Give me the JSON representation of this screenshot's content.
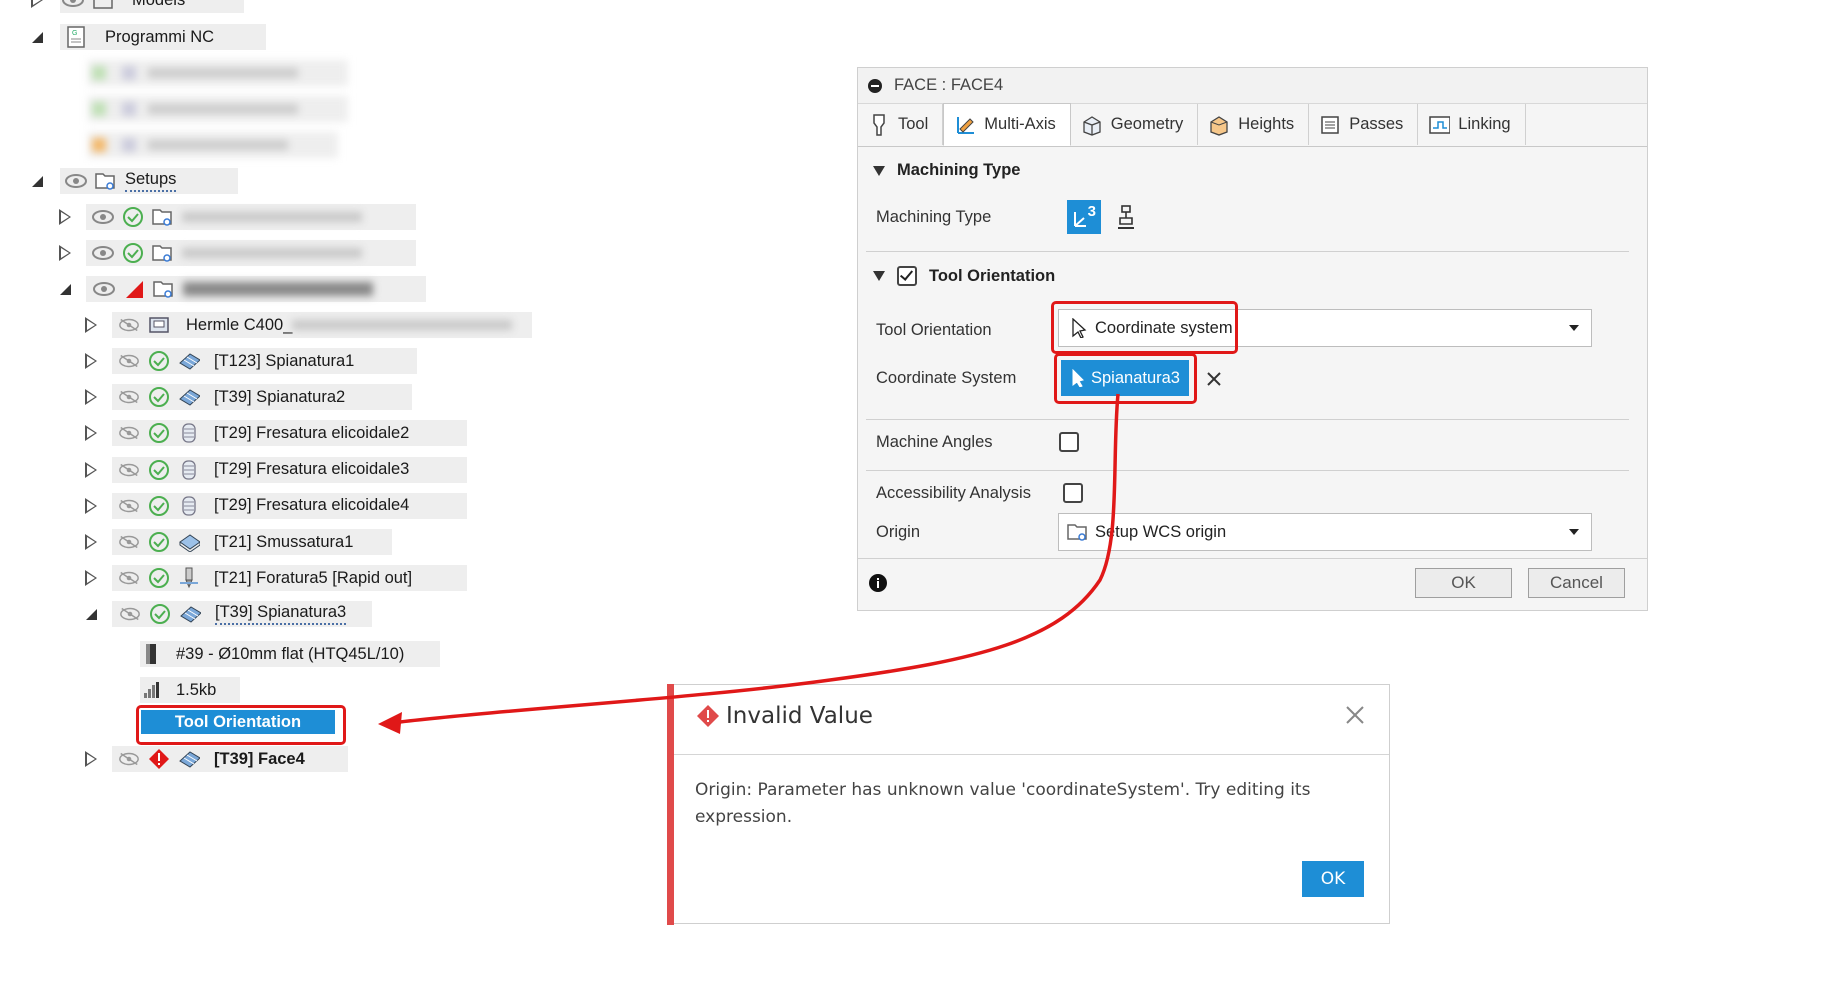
{
  "tree": {
    "models_label": "Models",
    "nc_programs_label": "Programmi NC",
    "setups_label": "Setups",
    "machine_label": "Hermle C400_",
    "operations": [
      "[T123] Spianatura1",
      "[T39] Spianatura2",
      "[T29] Fresatura elicoidale2",
      "[T29] Fresatura elicoidale3",
      "[T29] Fresatura elicoidale4",
      "[T21] Smussatura1",
      "[T21] Foratura5 [Rapid out]",
      "[T39] Spianatura3"
    ],
    "tool_label": "#39 - Ø10mm flat (HTQ45L/10)",
    "size_label": "1.5kb",
    "selected_label": "Tool Orientation",
    "face_label": "[T39] Face4"
  },
  "dialog": {
    "title": "FACE : FACE4",
    "tabs": [
      "Tool",
      "Multi-Axis",
      "Geometry",
      "Heights",
      "Passes",
      "Linking"
    ],
    "active_tab": "Multi-Axis",
    "machining_type_header": "Machining Type",
    "machining_type_label": "Machining Type",
    "machining_type_badge": "3",
    "tool_orientation_header": "Tool Orientation",
    "tool_orientation_label": "Tool Orientation",
    "tool_orientation_value": "Coordinate system",
    "coordinate_system_label": "Coordinate System",
    "coordinate_system_value": "Spianatura3",
    "machine_angles_label": "Machine Angles",
    "accessibility_label": "Accessibility Analysis",
    "origin_label": "Origin",
    "origin_value": "Setup WCS origin",
    "ok_label": "OK",
    "cancel_label": "Cancel"
  },
  "error": {
    "title": "Invalid Value",
    "message": "Origin: Parameter has unknown value 'coordinateSystem'. Try editing its expression.",
    "ok_label": "OK"
  },
  "colors": {
    "accent_blue": "#1e8ed6",
    "annotation_red": "#e01818",
    "ok_green": "#4caf50",
    "error_red": "#e04a4a"
  }
}
